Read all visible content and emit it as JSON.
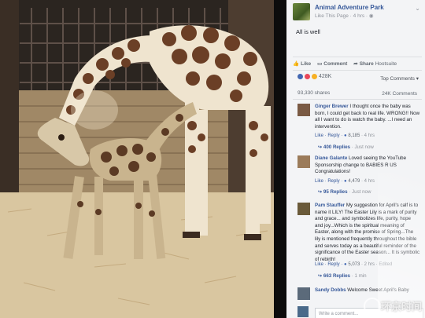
{
  "post": {
    "page_name": "Animal Adventure Park",
    "meta": "Like This Page · 4 hrs · ",
    "text": "All is well",
    "actions": {
      "like": "Like",
      "comment": "Comment",
      "share": "Share",
      "shared_by": "Hootsuite"
    },
    "reactions_count": "428K",
    "top_comments": "Top Comments ▾",
    "shares": "93,330 shares",
    "comments_count": "24K Comments"
  },
  "comments": [
    {
      "name": "Ginger Brewer",
      "text": "I thought once the baby was born, I could get back to real life. WRONG!! Now all I want to do is watch the baby. ...I need an intervention. ",
      "reply_label": "Like · Reply · ",
      "likes": "8,185",
      "time": " · 4 hrs",
      "replies": "400 Replies",
      "replies_time": " · Just now"
    },
    {
      "name": "Diane Galante",
      "text": "Loved seeing the YouTube Sponsorship change to BABIES R US  Congratulations!",
      "reply_label": "Like · Reply · ",
      "likes": "4,479",
      "time": " · 4 hrs",
      "replies": "95 Replies",
      "replies_time": " · Just now"
    },
    {
      "name": "Pam Stauffer",
      "text": "My suggestion for April's calf is to name it LILY!  The Easter Lily is a mark of purity and grace... and symbolizes life, purity, hope and joy...Which is the spiritual meaning of Easter, along with the promise of Spring...The lily is mentioned frequently throughout the bible and serves today as a beautiful reminder of the significance of the Easter season... It is symbolic of rebirth!",
      "reply_label": "Like · Reply · ",
      "likes": "5,073",
      "time": " · 2 hrs · Edited",
      "replies": "663 Replies",
      "replies_time": " · 1 min"
    },
    {
      "name": "Sandy Dobbs",
      "text": "Welcome Sweet April's Baby"
    }
  ],
  "input_placeholder": "Write a comment...",
  "watermark": "环京时间",
  "colors": {
    "link": "#365899",
    "meta": "#90949c",
    "bg": "#f3f4f6"
  },
  "icons": [
    "page-avatar",
    "like-icon",
    "comment-icon",
    "share-icon",
    "like-reaction-icon",
    "love-reaction-icon",
    "wow-reaction-icon"
  ]
}
